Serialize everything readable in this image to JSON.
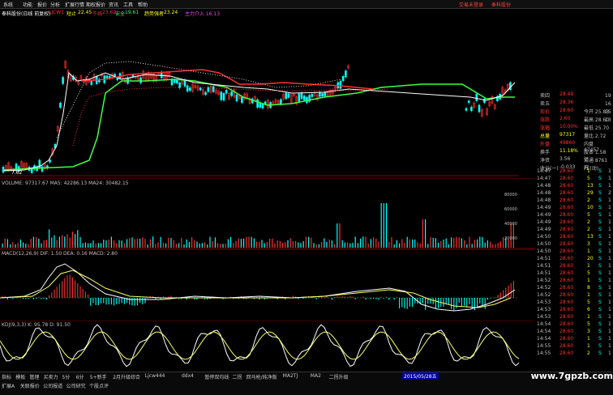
{
  "menu": {
    "items": [
      "系统",
      "功能",
      "报价",
      "分析",
      "扩展行情",
      "期权报价",
      "资讯",
      "工具",
      "帮助"
    ],
    "right_links": [
      "交易未登录",
      "奉科股份"
    ]
  },
  "chart_header": {
    "stock": "奉科股份(日线 前复权)",
    "indicator": "LJCW1",
    "stop_label": "短止",
    "stop_value": "22.45",
    "bull_label": "牛线",
    "bull_value": "23.62",
    "safe_label": "安全",
    "safe_value": "19.61",
    "line_label": "趋势强者",
    "line_value": "23.24",
    "extra": "主力介入  16.13"
  },
  "chart_labels": {
    "price_low": "7.62",
    "volume": "VOLUME: 97317.67  MA5: 42286.13  MA24: 30482.15",
    "macd": "MACD(12,26,9)  DIF: 1.50  DEA: 0.16  MACD: 2.80",
    "kdj": "KDJ(9,3,3)  K: 95.78  D: 91.50"
  },
  "volume_axis": [
    "80000",
    "60000",
    "40000",
    "20000"
  ],
  "quote": {
    "rows": [
      {
        "label": "卖四",
        "value": "28.49",
        "extra": "",
        "label_color": "#c0c0c0",
        "value_color": "#ff3030"
      },
      {
        "label": "卖五",
        "value": "28.36",
        "extra": "",
        "label_color": "#c0c0c0",
        "value_color": "#ff3030"
      },
      {
        "label": "现价",
        "value": "28.60",
        "extra": "今开  25.83",
        "label_color": "#ff3030",
        "value_color": "#ff3030"
      },
      {
        "label": "涨跌",
        "value": "2.60",
        "extra": "最高  28.60",
        "label_color": "#ff3030",
        "value_color": "#ff3030"
      },
      {
        "label": "涨幅",
        "value": "10.00%",
        "extra": "最低  25.70",
        "label_color": "#ff3030",
        "value_color": "#ff3030"
      },
      {
        "label": "总量",
        "value": "97317",
        "extra": "量比  2.72",
        "label_color": "#ffff00",
        "value_color": "#ffff00"
      },
      {
        "label": "外盘",
        "value": "49860",
        "extra": "内盘  47457",
        "label_color": "#ff3030",
        "value_color": "#ff3030"
      },
      {
        "label": "换手",
        "value": "11.18%",
        "extra": "股本  1.58亿",
        "label_color": "#c0c0c0",
        "value_color": "#ffff00"
      },
      {
        "label": "净资",
        "value": "3.56",
        "extra": "流通  8761万",
        "label_color": "#c0c0c0",
        "value_color": "#c0c0c0"
      },
      {
        "label": "收益(一)",
        "value": "-0.033",
        "extra": "PE(动)",
        "label_color": "#c0c0c0",
        "value_color": "#c0c0c0"
      }
    ],
    "side_marks": [
      "19",
      "16",
      "15",
      "13"
    ]
  },
  "ticks": [
    {
      "time": "14:47",
      "price": "28.60",
      "vol": "1",
      "flag": "S",
      "n": "1"
    },
    {
      "time": "14:47",
      "price": "28.60",
      "vol": "5",
      "flag": "S",
      "n": "1"
    },
    {
      "time": "14:48",
      "price": "28.60",
      "vol": "13",
      "flag": "S",
      "n": "1"
    },
    {
      "time": "14:48",
      "price": "28.60",
      "vol": "29",
      "flag": "S",
      "n": "2"
    },
    {
      "time": "14:48",
      "price": "28.60",
      "vol": "2",
      "flag": "S",
      "n": "1"
    },
    {
      "time": "14:49",
      "price": "28.60",
      "vol": "10",
      "flag": "S",
      "n": "1"
    },
    {
      "time": "14:49",
      "price": "28.60",
      "vol": "5",
      "flag": "S",
      "n": "1"
    },
    {
      "time": "14:49",
      "price": "28.60",
      "vol": "2",
      "flag": "S",
      "n": "1"
    },
    {
      "time": "14:49",
      "price": "28.60",
      "vol": "2",
      "flag": "S",
      "n": "1"
    },
    {
      "time": "14:50",
      "price": "28.60",
      "vol": "13",
      "flag": "S",
      "n": "1"
    },
    {
      "time": "14:50",
      "price": "28.60",
      "vol": "3",
      "flag": "S",
      "n": "1"
    },
    {
      "time": "14:50",
      "price": "28.60",
      "vol": "1",
      "flag": "S",
      "n": "1"
    },
    {
      "time": "14:51",
      "price": "28.60",
      "vol": "20",
      "flag": "S",
      "n": "1"
    },
    {
      "time": "14:51",
      "price": "28.60",
      "vol": "1",
      "flag": "S",
      "n": "1"
    },
    {
      "time": "14:51",
      "price": "28.60",
      "vol": "5",
      "flag": "S",
      "n": "1"
    },
    {
      "time": "14:52",
      "price": "28.60",
      "vol": "1",
      "flag": "S",
      "n": "1"
    },
    {
      "time": "14:52",
      "price": "28.60",
      "vol": "8",
      "flag": "S",
      "n": "1"
    },
    {
      "time": "14:52",
      "price": "28.60",
      "vol": "1",
      "flag": "S",
      "n": "1"
    },
    {
      "time": "14:53",
      "price": "28.60",
      "vol": "5",
      "flag": "S",
      "n": "1"
    },
    {
      "time": "14:53",
      "price": "28.60",
      "vol": "6",
      "flag": "S",
      "n": "1"
    },
    {
      "time": "14:53",
      "price": "28.60",
      "vol": "1",
      "flag": "S",
      "n": "1"
    },
    {
      "time": "14:54",
      "price": "28.60",
      "vol": "5",
      "flag": "S",
      "n": "1"
    },
    {
      "time": "14:54",
      "price": "28.60",
      "vol": "3",
      "flag": "S",
      "n": "1"
    },
    {
      "time": "14:54",
      "price": "28.60",
      "vol": "1",
      "flag": "S",
      "n": "1"
    },
    {
      "time": "14:55",
      "price": "28.60",
      "vol": "1",
      "flag": "S",
      "n": "1"
    },
    {
      "time": "14:55",
      "price": "28.60",
      "vol": "2",
      "flag": "S",
      "n": "1"
    }
  ],
  "bottom": {
    "tabs_row1": [
      "指标",
      "模板",
      "管理",
      "买卖力",
      "5分",
      "6分",
      "5+新手",
      "2月升级综合",
      "Ljcw444",
      "ddx4",
      "暂停双均线",
      "二拐",
      "回马枪/纯净版",
      "MA2TJ",
      "MA2",
      "二拐升级"
    ],
    "tabs_row2": [
      "扩展A",
      "关联报价",
      "公司报道",
      "公司研究",
      "个股点评"
    ],
    "date_badge": "2015/05/28五"
  },
  "watermark": "www.7gpzb.com",
  "colors": {
    "up": "#ff3030",
    "down": "#00ffff",
    "green_line": "#40ff40",
    "white_line": "#ffffff",
    "yellow": "#ffff00"
  }
}
